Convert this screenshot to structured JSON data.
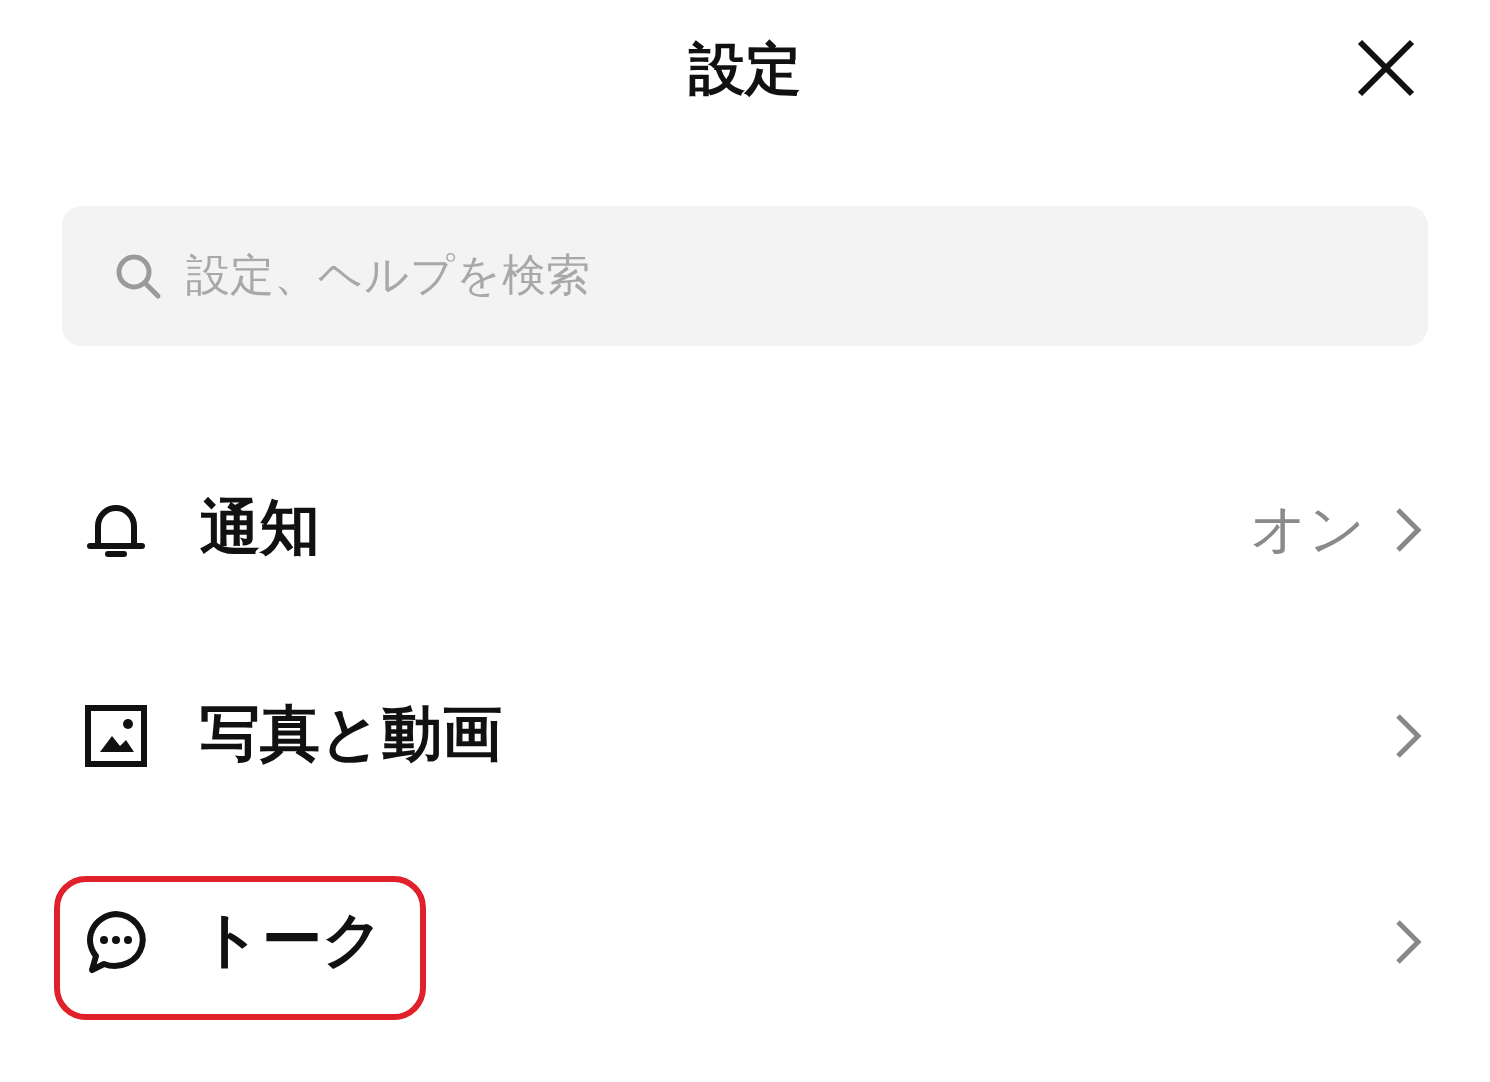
{
  "header": {
    "title": "設定"
  },
  "search": {
    "placeholder": "設定、ヘルプを検索"
  },
  "items": [
    {
      "label": "通知",
      "value": "オン",
      "highlighted": false
    },
    {
      "label": "写真と動画",
      "highlighted": false
    },
    {
      "label": "トーク",
      "highlighted": true
    }
  ]
}
